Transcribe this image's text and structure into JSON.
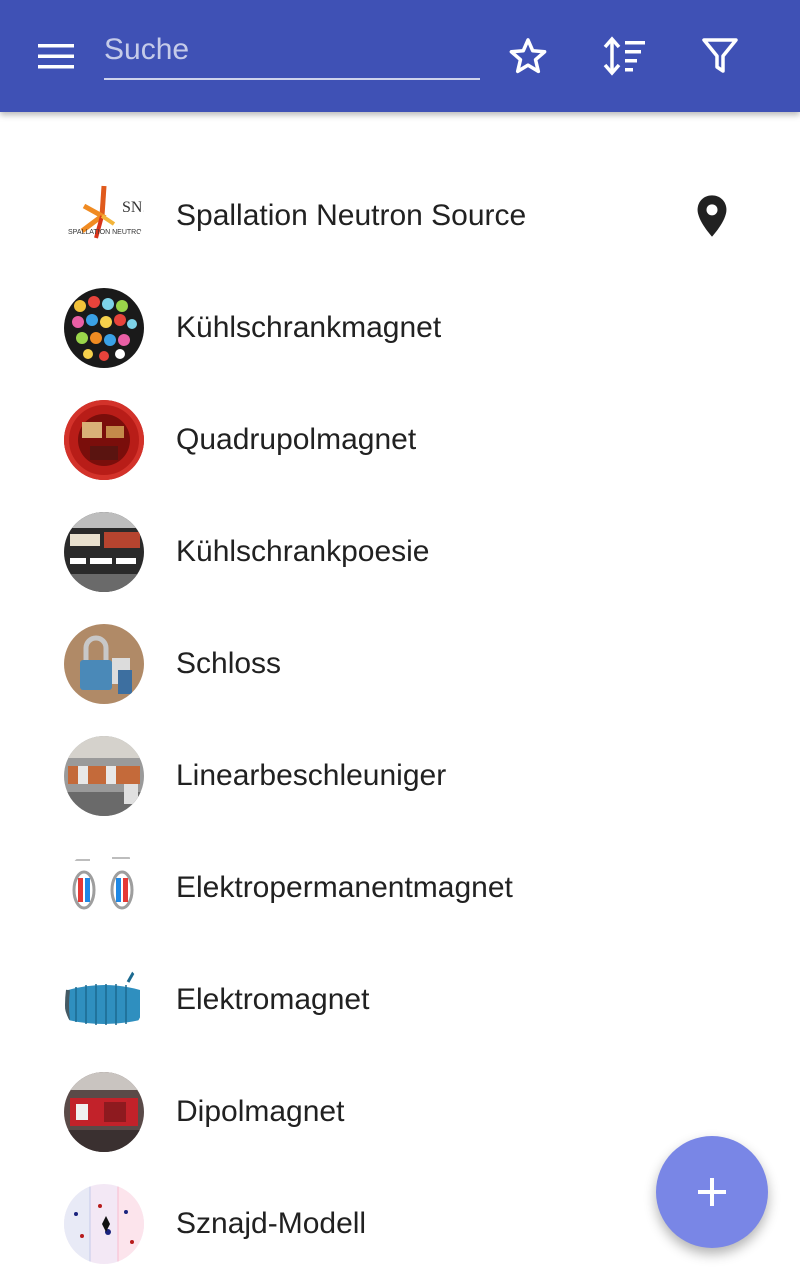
{
  "toolbar": {
    "search_placeholder": "Suche",
    "search_value": "",
    "menu_icon": "menu-icon",
    "favorites_icon": "star-outline-icon",
    "sort_icon": "sort-icon",
    "filter_icon": "filter-icon",
    "color": "#3f51b5"
  },
  "items": [
    {
      "label": "Spallation Neutron Source",
      "has_location": true
    },
    {
      "label": "Kühlschrankmagnet"
    },
    {
      "label": "Quadrupolmagnet"
    },
    {
      "label": "Kühlschrankpoesie"
    },
    {
      "label": "Schloss"
    },
    {
      "label": "Linearbeschleuniger"
    },
    {
      "label": "Elektropermanentmagnet"
    },
    {
      "label": "Elektromagnet"
    },
    {
      "label": "Dipolmagnet"
    },
    {
      "label": "Sznajd-Modell"
    }
  ],
  "fab": {
    "icon": "plus-icon",
    "color": "#7986e6"
  }
}
